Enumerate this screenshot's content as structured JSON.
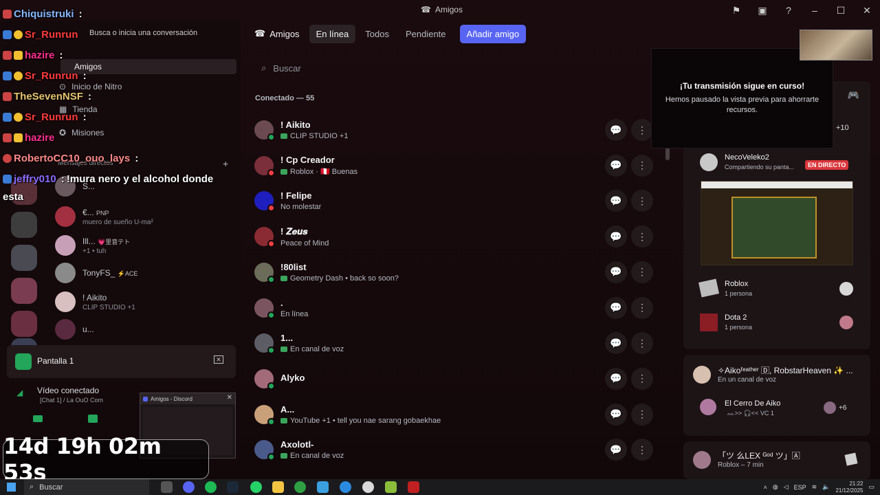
{
  "window": {
    "title": "Amigos"
  },
  "topnav": {
    "title": "Amigos",
    "tabs": [
      {
        "label": "En línea",
        "active": true
      },
      {
        "label": "Todos",
        "active": false
      },
      {
        "label": "Pendiente",
        "active": false
      }
    ],
    "add_friend": "Añadir amigo"
  },
  "search": {
    "placeholder": "Buscar"
  },
  "friends": {
    "section_label": "Conectado — 55",
    "items": [
      {
        "name": "! Aikito",
        "sub": "CLIP STUDIO +1",
        "status": "online",
        "icon": "gamepad-icon",
        "color": "#6b4a52"
      },
      {
        "name": "! Cp Creador",
        "sub": "Roblox · 🇵🇪 Buenas",
        "status": "dnd",
        "icon": "gamepad-icon",
        "color": "#7a2f3a"
      },
      {
        "name": "! Felipe",
        "sub": "No molestar",
        "status": "dnd",
        "icon": "",
        "color": "#1f1fbf"
      },
      {
        "name": "! 𝒁𝒆𝒖𝒔",
        "sub": "Peace of Mind",
        "status": "dnd",
        "icon": "",
        "color": "#8a2b33"
      },
      {
        "name": "!80list",
        "sub": "Geometry Dash • back so soon?",
        "status": "online",
        "icon": "gamepad-icon",
        "color": "#6c6c5a"
      },
      {
        "name": ".",
        "sub": "En línea",
        "status": "online",
        "icon": "",
        "color": "#7a5560"
      },
      {
        "name": "1...",
        "sub": "En canal de voz",
        "status": "online",
        "icon": "voice-icon",
        "color": "#5d5d66"
      },
      {
        "name": "Alyko",
        "sub": "",
        "status": "online",
        "icon": "",
        "color": "#a36a7a"
      },
      {
        "name": "A...",
        "sub": "YouTube +1 • tell you nae sarang gobaekhae",
        "status": "online",
        "icon": "gamepad-icon",
        "color": "#c9a07a"
      },
      {
        "name": "Axolotl-",
        "sub": "En canal de voz",
        "status": "online",
        "icon": "voice-icon",
        "color": "#4a5a8a"
      }
    ]
  },
  "sidebar": {
    "search_placeholder": "Busca o inicia una conversación",
    "nav": [
      "Amigos",
      "Inicio de Nitro",
      "Tienda",
      "Misiones"
    ],
    "dm_header": "Mensajes directos",
    "dms": [
      {
        "name": "S...",
        "sub": ""
      },
      {
        "name": "€...",
        "tag": "PNP",
        "sub": "muero de sueño U-ma²"
      },
      {
        "name": "Ill...",
        "tag": "💗里音テト",
        "sub": "+1 • tuh"
      },
      {
        "name": "TonyFS_",
        "tag": "⚡ACE",
        "sub": ""
      },
      {
        "name": "! Aikito",
        "tag": "",
        "sub": "CLIP STUDIO +1"
      },
      {
        "name": "u...",
        "tag": "",
        "sub": ""
      }
    ]
  },
  "chat_overlay": [
    {
      "user": "Chiquistruki",
      "color": "#86b7ff",
      "msg": ""
    },
    {
      "user": "Sr_Runrun",
      "color": "#ff3b3b",
      "msg": ""
    },
    {
      "user": "hazire",
      "color": "#ff2f8f",
      "msg": ""
    },
    {
      "user": "Sr_Runrun",
      "color": "#ff3b3b",
      "msg": ""
    },
    {
      "user": "TheSevenNSF",
      "color": "#e6c46e",
      "msg": ""
    },
    {
      "user": "Sr_Runrun",
      "color": "#ff3b3b",
      "msg": ""
    },
    {
      "user": "hazire",
      "color": "#ff2f8f",
      "msg": ""
    },
    {
      "user": "RobertoCC10_ouo_lays",
      "color": "#ff8a8a",
      "msg": ""
    },
    {
      "user": "jeffry010",
      "color": "#8a6bff",
      "msg": "!mura nero y el alcohol donde"
    },
    {
      "user": "",
      "color": "#ffffff",
      "msg": "esta"
    }
  ],
  "stream": {
    "screen_label": "Pantalla 1",
    "video_status": "Vídeo conectado",
    "video_sub": "[Chat 1] / La OuO Com",
    "mini_window_title": "Amigos - Discord",
    "timer": "14d 19h 02m 53s"
  },
  "right_panel": {
    "popup_title": "¡Tu transmisión sigue en curso!",
    "popup_body": "Hemos pausado la vista previa para ahorrarte recursos.",
    "plus_count": "+10",
    "streamer_name": "NecoVeleko2",
    "streamer_sub": "Compartiendo su panta...",
    "live_label": "EN DIRECTO",
    "games": [
      {
        "name": "Roblox",
        "sub": "1 persona"
      },
      {
        "name": "Dota 2",
        "sub": "1 persona"
      }
    ],
    "voice_title": "✧Aikoᶠᵉᵃᵗʰᵉʳ 🄳, RobstarHeaven ✨ ...",
    "voice_sub": "En un canal de voz",
    "voice_channel": "El Cerro De Aiko",
    "voice_channel_sub": "ᨐ>> 🎧<< VC 1",
    "voice_plus": "+6",
    "last_name": "「ツ 么LEX ᴳᵒᵈ ツ」🄰",
    "last_sub": "Roblox – 7 min"
  },
  "taskbar": {
    "search": "Buscar",
    "lang": "ESP",
    "time": "21:22",
    "date": "21/12/2025"
  }
}
